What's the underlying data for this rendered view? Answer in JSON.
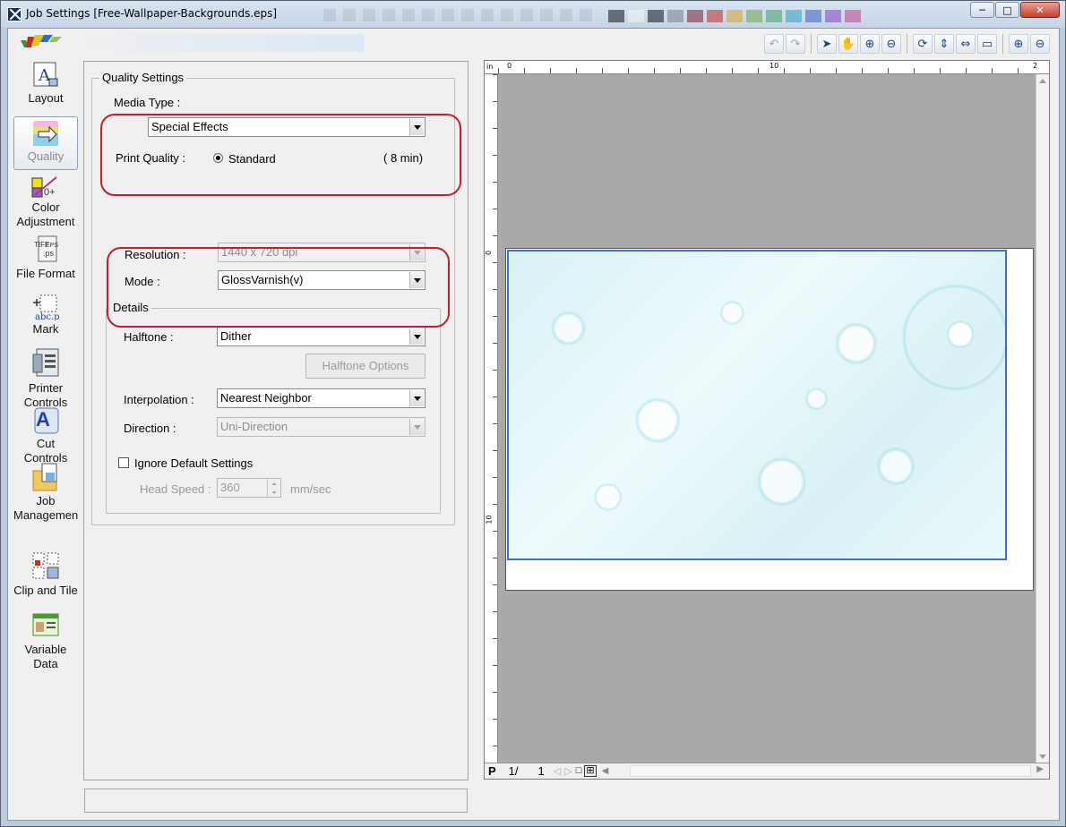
{
  "window": {
    "title": "Job Settings [Free-Wallpaper-Backgrounds.eps]",
    "minimize": "─",
    "maximize": "□",
    "close": "✕",
    "title_swatches": [
      "#111111",
      "#f2f2f2",
      "#111111",
      "#808080",
      "#7b1f2a",
      "#c0282a",
      "#d9a02a",
      "#6aa64a",
      "#3fa36a",
      "#2aa3c3",
      "#3f5fbf",
      "#8a3fbf",
      "#c03f8a"
    ]
  },
  "toolbar": {
    "icons": [
      "undo-icon",
      "redo-icon",
      "pointer-icon",
      "hand-icon",
      "zoom-in-icon",
      "zoom-out-icon",
      "rotate-icon",
      "fit-width-icon",
      "fit-height-icon",
      "fit-page-icon",
      "plus-icon",
      "minus-icon"
    ],
    "glyphs": {
      "undo": "↶",
      "redo": "↷",
      "pointer": "➤",
      "hand": "✋",
      "zoom_in": "⊕",
      "zoom_out": "⊖",
      "rotate": "⟳",
      "fit_width": "⇔",
      "fit_height": "⇕",
      "fit_page": "▭",
      "plus": "⊕",
      "minus": "⊖"
    }
  },
  "nav": {
    "items": [
      {
        "label1": "Layout",
        "label2": "",
        "icon": "layout-icon"
      },
      {
        "label1": "Quality",
        "label2": "",
        "icon": "quality-icon"
      },
      {
        "label1": "Color",
        "label2": "Adjustment",
        "icon": "color-adjustment-icon"
      },
      {
        "label1": "File Format",
        "label2": "",
        "icon": "file-format-icon"
      },
      {
        "label1": "Mark",
        "label2": "",
        "icon": "mark-icon"
      },
      {
        "label1": "Printer",
        "label2": "Controls",
        "icon": "printer-controls-icon"
      },
      {
        "label1": "Cut",
        "label2": "Controls",
        "icon": "cut-controls-icon"
      },
      {
        "label1": "Job",
        "label2": "Managemen",
        "icon": "job-management-icon"
      },
      {
        "label1": "Clip and Tile",
        "label2": "",
        "icon": "clip-tile-icon"
      },
      {
        "label1": "Variable",
        "label2": "Data",
        "icon": "variable-data-icon"
      }
    ],
    "active": "Quality"
  },
  "quality": {
    "group_title": "Quality Settings",
    "media_type_label": "Media Type :",
    "media_type_value": "Special Effects",
    "print_quality_label": "Print Quality :",
    "print_quality_option": "Standard",
    "print_quality_time": "( 8 min)",
    "resolution_label": "Resolution :",
    "resolution_value": "1440 x 720 dpi",
    "mode_label": "Mode :",
    "mode_value": "GlossVarnish(v)"
  },
  "details": {
    "group_title": "Details",
    "halftone_label": "Halftone :",
    "halftone_value": "Dither",
    "halftone_options_button": "Halftone Options",
    "interpolation_label": "Interpolation :",
    "interpolation_value": "Nearest Neighbor",
    "direction_label": "Direction :",
    "direction_value": "Uni-Direction",
    "ignore_defaults_label": "Ignore Default Settings",
    "head_speed_label": "Head Speed :",
    "head_speed_value": "360",
    "head_speed_unit": "mm/sec"
  },
  "preview": {
    "ruler_unit": "in",
    "ruler_h_labels": [
      "0",
      "10",
      "2"
    ],
    "ruler_v_labels": [
      "0",
      "10"
    ],
    "pager": {
      "p": "P",
      "page": "1/",
      "total": "1"
    },
    "highlight_color": "#c81e2a"
  }
}
